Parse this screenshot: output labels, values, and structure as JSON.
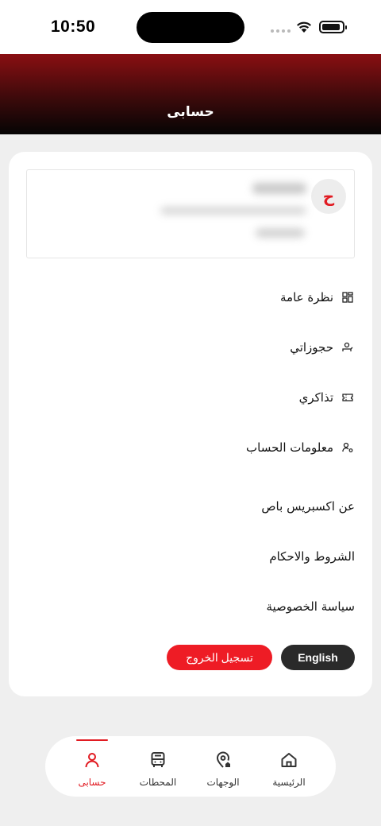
{
  "status_bar": {
    "time": "10:50"
  },
  "header": {
    "title": "حسابى"
  },
  "profile": {
    "avatar_initial": "ح"
  },
  "menu": [
    {
      "label": "نظرة عامة",
      "icon": "grid-icon"
    },
    {
      "label": "حجوزاتي",
      "icon": "bookings-icon"
    },
    {
      "label": "تذاكري",
      "icon": "ticket-icon"
    },
    {
      "label": "معلومات الحساب",
      "icon": "account-settings-icon"
    }
  ],
  "links": [
    {
      "label": "عن اكسبريس باص"
    },
    {
      "label": "الشروط والاحكام"
    },
    {
      "label": "سياسة الخصوصية"
    }
  ],
  "buttons": {
    "english": "English",
    "logout": "تسجيل الخروج"
  },
  "tabbar": {
    "accent_color": "#e11b22",
    "tabs": [
      {
        "label": "الرئيسية",
        "icon": "home-icon",
        "active": false
      },
      {
        "label": "الوجهات",
        "icon": "location-pin-icon",
        "active": false
      },
      {
        "label": "المحطات",
        "icon": "bus-icon",
        "active": false
      },
      {
        "label": "حسابى",
        "icon": "user-icon",
        "active": true
      }
    ]
  }
}
